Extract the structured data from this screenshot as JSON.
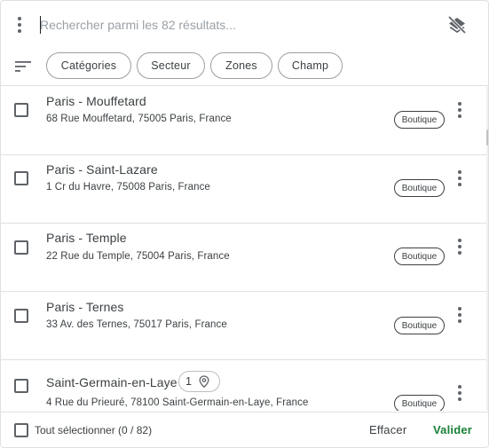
{
  "search": {
    "placeholder": "Rechercher parmi les 82 résultats..."
  },
  "filters": {
    "chips": [
      {
        "label": "Catégories"
      },
      {
        "label": "Secteur"
      },
      {
        "label": "Zones"
      },
      {
        "label": "Champ"
      }
    ]
  },
  "results": [
    {
      "name": "Paris - Mouffetard",
      "address": "68 Rue Mouffetard, 75005 Paris, France",
      "badge": "Boutique",
      "checked": false
    },
    {
      "name": "Paris - Saint-Lazare",
      "address": "1 Cr du Havre, 75008 Paris, France",
      "badge": "Boutique",
      "checked": false
    },
    {
      "name": "Paris - Temple",
      "address": "22 Rue du Temple, 75004 Paris, France",
      "badge": "Boutique",
      "checked": false
    },
    {
      "name": "Paris - Ternes",
      "address": "33 Av. des Ternes, 75017 Paris, France",
      "badge": "Boutique",
      "checked": false
    },
    {
      "name": "Saint-Germain-en-Laye",
      "address": "4 Rue du Prieuré, 78100 Saint-Germain-en-Laye, France",
      "badge": "Boutique",
      "checked": false,
      "count": "1"
    }
  ],
  "footer": {
    "select_all_label": "Tout sélectionner (0 / 82)",
    "clear_label": "Effacer",
    "validate_label": "Valider"
  },
  "colors": {
    "accent_green": "#188038",
    "text": "#3c4043",
    "divider": "#e0e0e0"
  },
  "icons": {
    "menu": "more-vert-icon",
    "layers": "layers-clear-icon",
    "sort": "sort-icon",
    "pin": "location-pin-icon"
  }
}
